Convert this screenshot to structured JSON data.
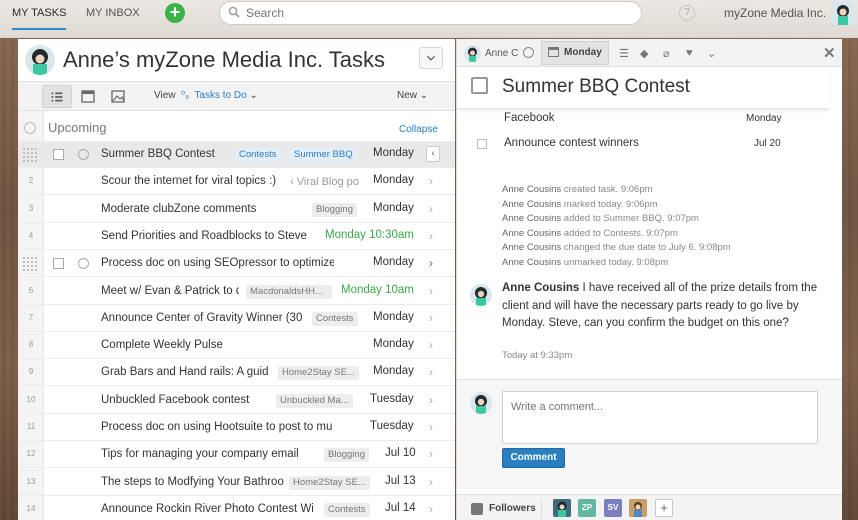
{
  "topbar": {
    "nav_my_tasks": "MY TASKS",
    "nav_my_inbox": "MY INBOX",
    "add_label": "+",
    "search_placeholder": "Search",
    "help_label": "?",
    "org_name": "myZone Media Inc."
  },
  "left": {
    "title": "Anne’s myZone Media Inc. Tasks",
    "view_label": "View",
    "view_value": "Tasks to Do",
    "new_label": "New",
    "section_title": "Upcoming",
    "collapse_label": "Collapse",
    "tasks": [
      {
        "num": "",
        "name": "Summer BBQ Contest",
        "tags": [
          "Contests",
          "Summer BBQ"
        ],
        "due": "Monday",
        "selected": true
      },
      {
        "num": "2",
        "name": "Scour the internet for viral topics :)",
        "tags": [
          "‹ Viral Blog po"
        ],
        "due": "Monday"
      },
      {
        "num": "3",
        "name": "Moderate clubZone comments",
        "tags": [
          "Blogging"
        ],
        "due": "Monday"
      },
      {
        "num": "4",
        "name": "Send Priorities and Roadblocks to Steve",
        "tags": [],
        "due": "Monday 10:30am",
        "due_color": "green"
      },
      {
        "num": "",
        "name": "Process doc on using SEOpressor to optimize artic",
        "tags": [],
        "due": "Monday",
        "hover": true
      },
      {
        "num": "6",
        "name": "Meet w/ Evan & Patrick to d",
        "tags": [
          "MacdonaldsHH..."
        ],
        "due": "Monday 10am",
        "due_color": "green"
      },
      {
        "num": "7",
        "name": "Announce Center of Gravity Winner (30",
        "tags": [
          "Contests"
        ],
        "due": "Monday"
      },
      {
        "num": "8",
        "name": "Complete Weekly Pulse",
        "tags": [],
        "due": "Monday"
      },
      {
        "num": "9",
        "name": "Grab Bars and Hand rails: A guid",
        "tags": [
          "Home2Stay SE..."
        ],
        "due": "Monday"
      },
      {
        "num": "10",
        "name": "Unbuckled Facebook contest",
        "tags": [
          "Unbuckled Ma..."
        ],
        "due": "Tuesday"
      },
      {
        "num": "11",
        "name": "Process doc on using Hootsuite to post to multiple",
        "tags": [],
        "due": "Tuesday"
      },
      {
        "num": "12",
        "name": "Tips for managing your company email",
        "tags": [
          "Blogging"
        ],
        "due": "Jul 10"
      },
      {
        "num": "13",
        "name": "The steps to Modfying Your Bathroo",
        "tags": [
          "Home2Stay SE..."
        ],
        "due": "Jul 13"
      },
      {
        "num": "14",
        "name": "Announce Rockin River Photo Contest Wi",
        "tags": [
          "Contests"
        ],
        "due": "Jul 14"
      }
    ]
  },
  "right": {
    "assignee": "Anne C",
    "due_tab": "Monday",
    "title": "Summer BBQ Contest",
    "subtasks": [
      {
        "name": "Facebook",
        "due": "Monday"
      },
      {
        "name": "Announce contest winners",
        "due": "Jul 20"
      }
    ],
    "stories": [
      {
        "actor": "Anne Cousins",
        "text": " created task.  9:06pm"
      },
      {
        "actor": "Anne Cousins",
        "text": " marked today.  9:06pm"
      },
      {
        "actor": "Anne Cousins",
        "text": " added to Summer BBQ.  9:07pm"
      },
      {
        "actor": "Anne Cousins",
        "text": " added to Contests.  9:07pm"
      },
      {
        "actor": "Anne Cousins",
        "text": " changed the due date to July 6.  9:08pm"
      },
      {
        "actor": "Anne Cousins",
        "text": " unmarked today.  9:08pm"
      }
    ],
    "comment": {
      "author": "Anne Cousins",
      "text": " I have received all of the prize details from the client and will have the necessary parts ready to go live by Monday. Steve, can you confirm the budget on this one?",
      "time": "Today at 9:33pm"
    },
    "composer_placeholder": "Write a comment...",
    "comment_button": "Comment",
    "followers_label": "Followers",
    "followers": [
      {
        "initials": "",
        "color": "#3d6d7a"
      },
      {
        "initials": "ZP",
        "color": "#62b8a3"
      },
      {
        "initials": "SV",
        "color": "#7b7fbf"
      },
      {
        "initials": "",
        "color": "#c6a06a"
      }
    ],
    "add_follower": "+"
  },
  "colors": {
    "accent": "#2a7fc1",
    "green": "#3aa84a",
    "add_green": "#3cb34a"
  }
}
